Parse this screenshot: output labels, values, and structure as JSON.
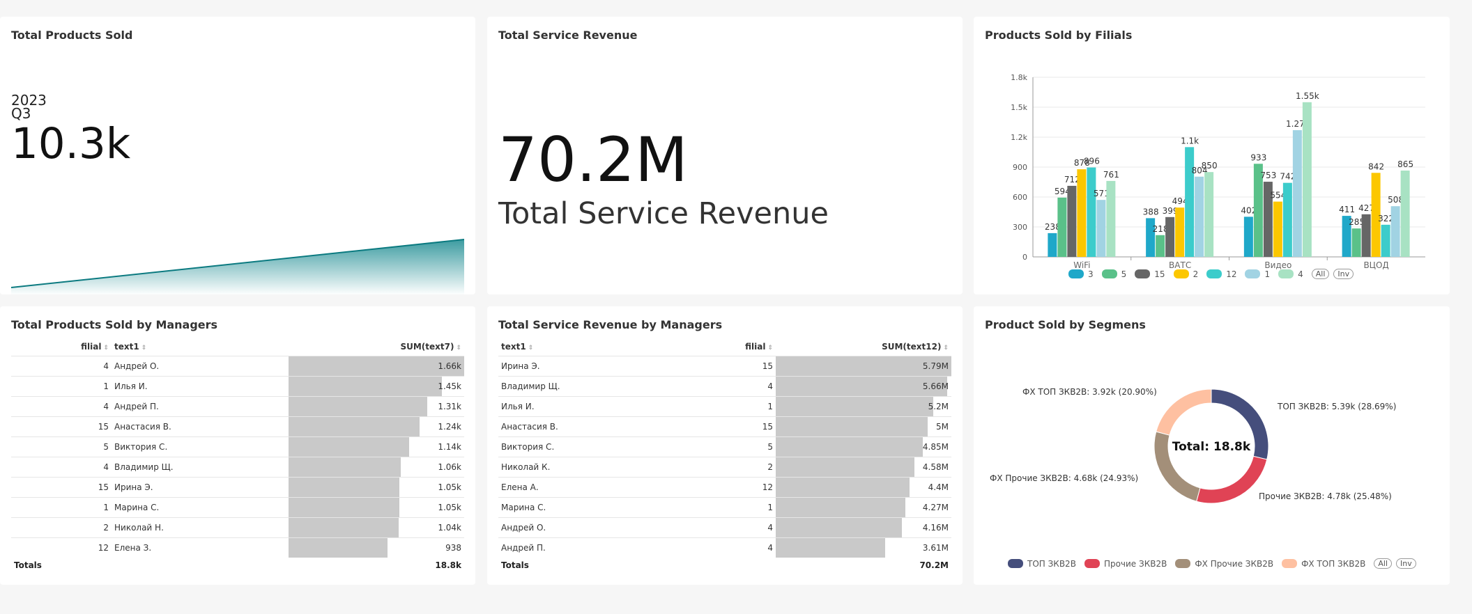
{
  "cards": {
    "products": {
      "title": "Total Products Sold",
      "year": "2023",
      "quarter": "Q3",
      "value": "10.3k",
      "trend": [
        0.2,
        0.3,
        0.45,
        0.55,
        0.7,
        0.85,
        1.0
      ]
    },
    "revenue": {
      "title": "Total Service Revenue",
      "value": "70.2M",
      "subtitle": "Total Service Revenue"
    },
    "filials": {
      "title": "Products Sold by Filials"
    },
    "managers_products": {
      "title": "Total Products Sold by Managers"
    },
    "managers_revenue": {
      "title": "Total Service Revenue by Managers"
    },
    "segments": {
      "title": "Product Sold by Segmens"
    }
  },
  "chart_data": [
    {
      "type": "bar",
      "title": "Products Sold by Filials",
      "categories": [
        "WiFi",
        "ВАТС",
        "Видео",
        "ВЦОД"
      ],
      "ylim": [
        0,
        1800
      ],
      "yticks": [
        "0",
        "300",
        "600",
        "900",
        "1.2k",
        "1.5k",
        "1.8k"
      ],
      "series": [
        {
          "name": "3",
          "color": "#1FA8C9",
          "values": [
            238,
            388,
            402,
            411
          ],
          "labels": [
            "238",
            "388",
            "402",
            "411"
          ]
        },
        {
          "name": "5",
          "color": "#5AC189",
          "values": [
            594,
            218,
            933,
            285
          ],
          "labels": [
            "594",
            "218",
            "933",
            "285"
          ]
        },
        {
          "name": "15",
          "color": "#666666",
          "values": [
            712,
            399,
            753,
            427
          ],
          "labels": [
            "712",
            "399",
            "753",
            "427"
          ]
        },
        {
          "name": "2",
          "color": "#FCC700",
          "values": [
            878,
            494,
            554,
            842
          ],
          "labels": [
            "878",
            "494",
            "554",
            "842"
          ]
        },
        {
          "name": "12",
          "color": "#3CCCCB",
          "values": [
            896,
            1100,
            742,
            322
          ],
          "labels": [
            "896",
            "1.1k",
            "742",
            "322"
          ]
        },
        {
          "name": "1",
          "color": "#A1D3E3",
          "values": [
            571,
            804,
            1270,
            508
          ],
          "labels": [
            "571",
            "804",
            "1.27k",
            "508"
          ]
        },
        {
          "name": "4",
          "color": "#A8E2C3",
          "values": [
            761,
            850,
            1550,
            865
          ],
          "labels": [
            "761",
            "850",
            "1.55k",
            "865"
          ]
        }
      ],
      "legend_buttons": [
        "All",
        "Inv"
      ]
    },
    {
      "type": "pie",
      "title": "Product Sold by Segmens",
      "center_label": "Total: 18.8k",
      "slices": [
        {
          "name": "ТОП ЗКВ2В",
          "value": 5390,
          "color": "#454E7C",
          "label": "ТОП ЗКВ2В: 5.39k (28.69%)"
        },
        {
          "name": "Прочие ЗКВ2В",
          "value": 4780,
          "color": "#E04355",
          "label": "Прочие ЗКВ2В: 4.78k (25.48%)"
        },
        {
          "name": "ФХ Прочие ЗКВ2В",
          "value": 4680,
          "color": "#A38F79",
          "label": "ФХ Прочие ЗКВ2В: 4.68k (24.93%)"
        },
        {
          "name": "ФХ ТОП ЗКВ2В",
          "value": 3920,
          "color": "#FEC0A1",
          "label": "ФХ ТОП ЗКВ2В: 3.92k (20.90%)"
        }
      ],
      "legend_buttons": [
        "All",
        "Inv"
      ]
    }
  ],
  "table1": {
    "headers": [
      "filial",
      "text1",
      "SUM(text7)"
    ],
    "max": 1660,
    "rows": [
      {
        "filial": "4",
        "name": "Андрей О.",
        "value": 1660,
        "label": "1.66k"
      },
      {
        "filial": "1",
        "name": "Илья И.",
        "value": 1450,
        "label": "1.45k"
      },
      {
        "filial": "4",
        "name": "Андрей П.",
        "value": 1310,
        "label": "1.31k"
      },
      {
        "filial": "15",
        "name": "Анастасия В.",
        "value": 1240,
        "label": "1.24k"
      },
      {
        "filial": "5",
        "name": "Виктория С.",
        "value": 1140,
        "label": "1.14k"
      },
      {
        "filial": "4",
        "name": "Владимир Щ.",
        "value": 1060,
        "label": "1.06k"
      },
      {
        "filial": "15",
        "name": "Ирина Э.",
        "value": 1050,
        "label": "1.05k"
      },
      {
        "filial": "1",
        "name": "Марина С.",
        "value": 1050,
        "label": "1.05k"
      },
      {
        "filial": "2",
        "name": "Николай Н.",
        "value": 1040,
        "label": "1.04k"
      },
      {
        "filial": "12",
        "name": "Елена З.",
        "value": 938,
        "label": "938"
      }
    ],
    "totals_label": "Totals",
    "totals_value": "18.8k"
  },
  "table2": {
    "headers": [
      "text1",
      "filial",
      "SUM(text12)"
    ],
    "max": 5790000,
    "rows": [
      {
        "name": "Ирина Э.",
        "filial": "15",
        "value": 5790000,
        "label": "5.79M"
      },
      {
        "name": "Владимир Щ.",
        "filial": "4",
        "value": 5660000,
        "label": "5.66M"
      },
      {
        "name": "Илья И.",
        "filial": "1",
        "value": 5200000,
        "label": "5.2M"
      },
      {
        "name": "Анастасия В.",
        "filial": "15",
        "value": 5000000,
        "label": "5M"
      },
      {
        "name": "Виктория С.",
        "filial": "5",
        "value": 4850000,
        "label": "4.85M"
      },
      {
        "name": "Николай К.",
        "filial": "2",
        "value": 4580000,
        "label": "4.58M"
      },
      {
        "name": "Елена А.",
        "filial": "12",
        "value": 4400000,
        "label": "4.4M"
      },
      {
        "name": "Марина С.",
        "filial": "1",
        "value": 4270000,
        "label": "4.27M"
      },
      {
        "name": "Андрей О.",
        "filial": "4",
        "value": 4160000,
        "label": "4.16M"
      },
      {
        "name": "Андрей П.",
        "filial": "4",
        "value": 3610000,
        "label": "3.61M"
      }
    ],
    "totals_label": "Totals",
    "totals_value": "70.2M"
  }
}
